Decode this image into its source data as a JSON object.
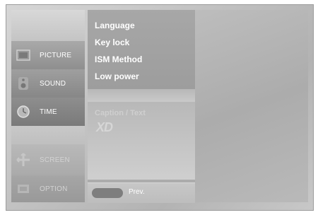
{
  "sidebar": {
    "items": [
      {
        "label": "PICTURE",
        "icon": "picture-icon"
      },
      {
        "label": "SOUND",
        "icon": "speaker-icon"
      },
      {
        "label": "TIME",
        "icon": "clock-icon"
      },
      {
        "label": "SCREEN",
        "icon": "screen-adjust-icon"
      },
      {
        "label": "OPTION",
        "icon": "option-icon"
      }
    ]
  },
  "menu": {
    "items": [
      "Language",
      "Key lock",
      "ISM Method",
      "Low power"
    ],
    "caption": "Caption / Text",
    "xd_logo": "XD"
  },
  "footer": {
    "prev_label": "Prev."
  }
}
